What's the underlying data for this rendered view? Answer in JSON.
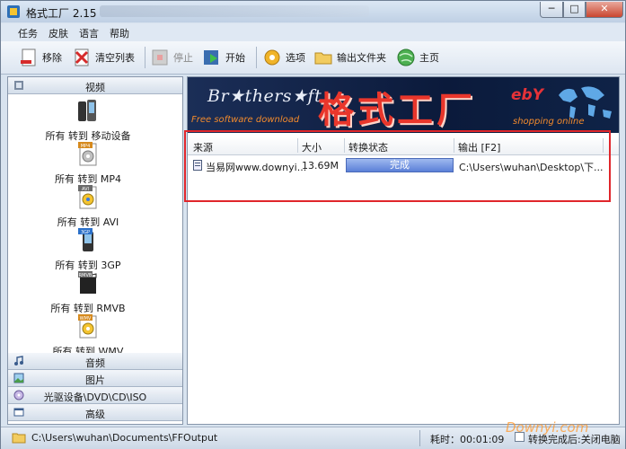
{
  "window": {
    "title": "格式工厂 2.15",
    "buttons": {
      "minimize": "─",
      "maximize": "□",
      "close": "✕"
    }
  },
  "menu": [
    "任务",
    "皮肤",
    "语言",
    "帮助"
  ],
  "toolbar": {
    "remove": "移除",
    "clear": "清空列表",
    "stop": "停止",
    "start": "开始",
    "options": "选项",
    "output_folder": "输出文件夹",
    "home": "主页"
  },
  "sidebar": {
    "video_header": "视频",
    "video_items": [
      {
        "label": "所有 转到 移动设备",
        "badge": ""
      },
      {
        "label": "所有 转到 MP4",
        "badge": "MP4"
      },
      {
        "label": "所有 转到 AVI",
        "badge": "AVI"
      },
      {
        "label": "所有 转到 3GP",
        "badge": "3GP"
      },
      {
        "label": "所有 转到 RMVB",
        "badge": "RMVB"
      },
      {
        "label": "所有 转到 WMV",
        "badge": "WMV"
      }
    ],
    "other_headers": [
      "音频",
      "图片",
      "光驱设备\\DVD\\CD\\ISO",
      "高级"
    ]
  },
  "banner": {
    "brothersoft": "Br★thers★ft",
    "free_text": "Free software download",
    "title": "格式工厂",
    "ebay": "ebY",
    "shopping": "shopping online"
  },
  "table": {
    "headers": [
      "来源",
      "大小",
      "转换状态",
      "输出 [F2]"
    ],
    "rows": [
      {
        "source": "当易网www.downyi...",
        "size": "13.69M",
        "status": "完成",
        "progress": 100,
        "output": "C:\\Users\\wuhan\\Desktop\\下..."
      }
    ]
  },
  "status": {
    "output_path": "C:\\Users\\wuhan\\Documents\\FFOutput",
    "elapsed": "耗时：00:01:09",
    "after_convert": "转换完成后:关闭电脑"
  },
  "watermark": "Downyi.com",
  "colors": {
    "accent": "#e0262b",
    "progress": "#5b80d8"
  }
}
